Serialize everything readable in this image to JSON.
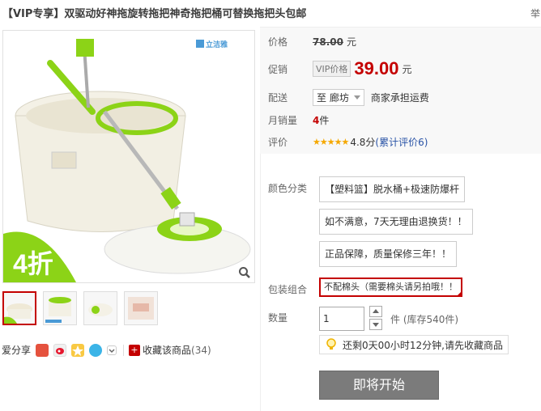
{
  "title": "【VIP专享】双驱动好神拖旋转拖把神奇拖把桶可替换拖把头包邮",
  "edge_char": "举",
  "brand": "立洁雅",
  "discount": "4折",
  "price_block": {
    "list_label": "价格",
    "list_price": "78.00",
    "currency": "元",
    "promo_label": "促销",
    "vip_tag": "VIP价格",
    "promo_price": "39.00",
    "ship_label": "配送",
    "ship_prefix": "至",
    "ship_location": "廊坊",
    "ship_note": "商家承担运费",
    "sales_label": "月销量",
    "sales_count": "4",
    "sales_unit": "件",
    "rating_label": "评价",
    "stars": "★★★★★",
    "score": "4.8分",
    "review_link": "(累计评价6)"
  },
  "options": {
    "color_label": "颜色分类",
    "color_items": [
      "【塑料篮】脱水桶+极速防爆杆",
      "如不满意，7天无理由退换货！！",
      "正品保障，质量保修三年！！"
    ],
    "pack_label": "包装组合",
    "pack_item": "不配棉头（需要棉头请另拍哦！！"
  },
  "quantity": {
    "label": "数量",
    "value": "1",
    "stock": "件 (库存540件)"
  },
  "notice": "还剩0天00小时12分钟,请先收藏商品",
  "buy_button": "即将开始",
  "share": {
    "label": "爱分享",
    "fav_label": "收藏该商品",
    "fav_count": "(34)"
  },
  "colors": {
    "accent": "#c40000",
    "green": "#8cd317",
    "star": "#f5a800",
    "link": "#2953a6"
  }
}
